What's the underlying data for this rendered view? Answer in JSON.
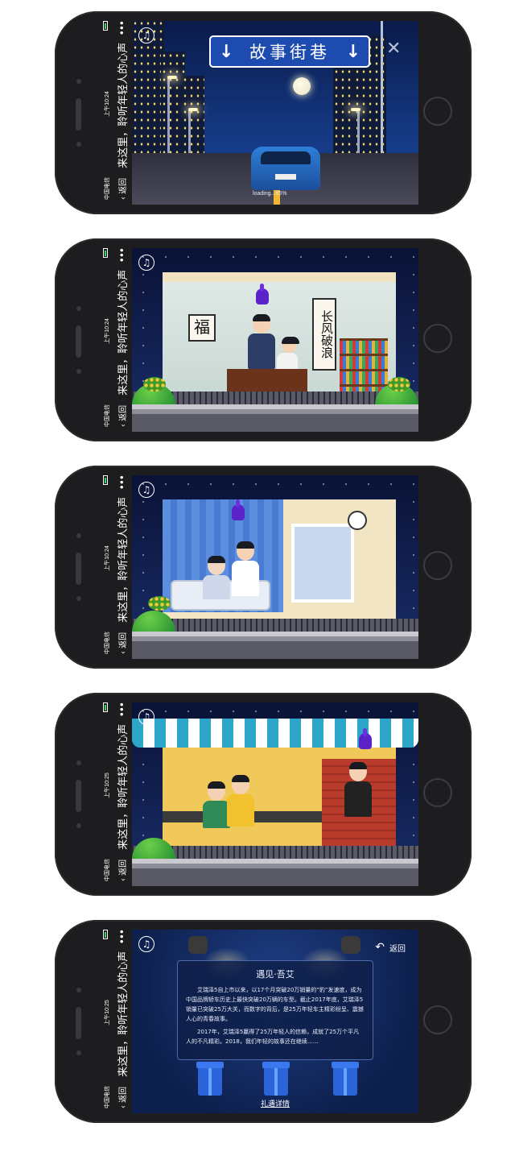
{
  "status_bar": {
    "carrier": "中国电信",
    "time_1": "上午10:24",
    "time_2": "上午10:24",
    "time_3": "上午10:24",
    "time_4": "上午10:25",
    "time_5": "上午10:25"
  },
  "nav": {
    "back_label": "返回",
    "page_title": "来这里，聆听年轻人的心声",
    "more_icon": "more-dots-icon"
  },
  "scene1": {
    "sign_text": "故事街巷",
    "loading_text": "loading.. 85%"
  },
  "scene2": {
    "scroll_fu": "福",
    "scroll_verse": "长风破浪"
  },
  "scene5": {
    "back_label": "返回",
    "card_title": "遇见·吾艾",
    "paragraph_1": "艾瑞泽5自上市以来，以17个月突破20万销量的“豹”发速度，成为中国品牌轿车历史上最快突破20万辆的车型。截止2017年底，艾瑞泽5销量已突破25万大关，而数字的背后，是25万年轻车主精彩纷呈、震撼人心的青春故事。",
    "paragraph_2": "2017年，艾瑞泽5赢得了25万年轻人的信赖，成就了25万个平凡人的不凡精彩。2018，我们年轻的故事还在继续……",
    "gift_link": "礼遇详情"
  },
  "colors": {
    "phone_body": "#1d1d1f",
    "sign_blue": "#1e4bb0",
    "awning_teal": "#2ea6c9",
    "tap_purple": "#5a22c8"
  }
}
